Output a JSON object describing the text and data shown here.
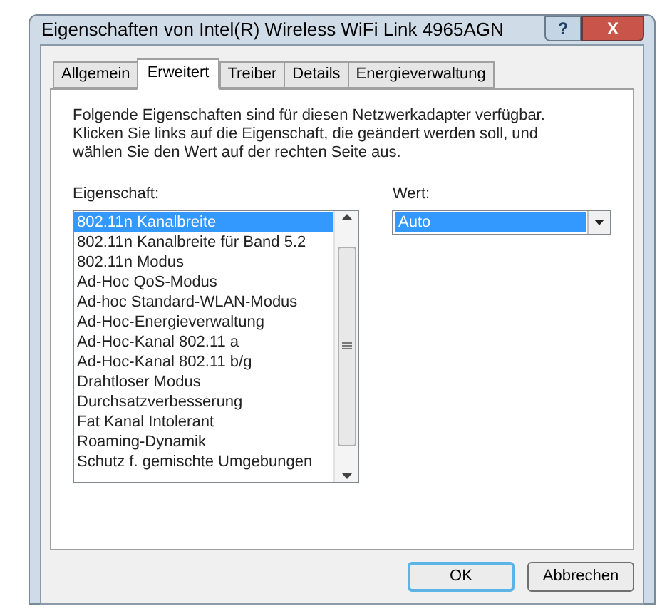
{
  "window": {
    "title": "Eigenschaften von Intel(R) Wireless WiFi Link 4965AGN",
    "title_buttons": [
      "?",
      "X"
    ]
  },
  "tabs": [
    {
      "label": "Allgemein",
      "selected": false
    },
    {
      "label": "Erweitert",
      "selected": true
    },
    {
      "label": "Treiber",
      "selected": false
    },
    {
      "label": "Details",
      "selected": false
    },
    {
      "label": "Energieverwaltung",
      "selected": false
    }
  ],
  "description": "Folgende Eigenschaften sind für diesen Netzwerkadapter verfügbar. Klicken Sie links auf die Eigenschaft, die geändert werden soll, und wählen Sie den Wert auf der rechten Seite aus.",
  "property_label": "Eigenschaft:",
  "properties": [
    {
      "label": "802.11n Kanalbreite",
      "selected": true
    },
    {
      "label": "802.11n Kanalbreite für Band 5.2",
      "selected": false
    },
    {
      "label": "802.11n Modus",
      "selected": false
    },
    {
      "label": "Ad-Hoc QoS-Modus",
      "selected": false
    },
    {
      "label": "Ad-hoc Standard-WLAN-Modus",
      "selected": false
    },
    {
      "label": "Ad-Hoc-Energieverwaltung",
      "selected": false
    },
    {
      "label": "Ad-Hoc-Kanal 802.11 a",
      "selected": false
    },
    {
      "label": "Ad-Hoc-Kanal 802.11 b/g",
      "selected": false
    },
    {
      "label": "Drahtloser Modus",
      "selected": false
    },
    {
      "label": "Durchsatzverbesserung",
      "selected": false
    },
    {
      "label": "Fat Kanal Intolerant",
      "selected": false
    },
    {
      "label": "Roaming-Dynamik",
      "selected": false
    },
    {
      "label": "Schutz f. gemischte Umgebungen",
      "selected": false
    }
  ],
  "value_label": "Wert:",
  "value": "Auto",
  "buttons": [
    {
      "label": "OK",
      "kind": "default"
    },
    {
      "label": "Abbrechen",
      "kind": "normal"
    }
  ]
}
